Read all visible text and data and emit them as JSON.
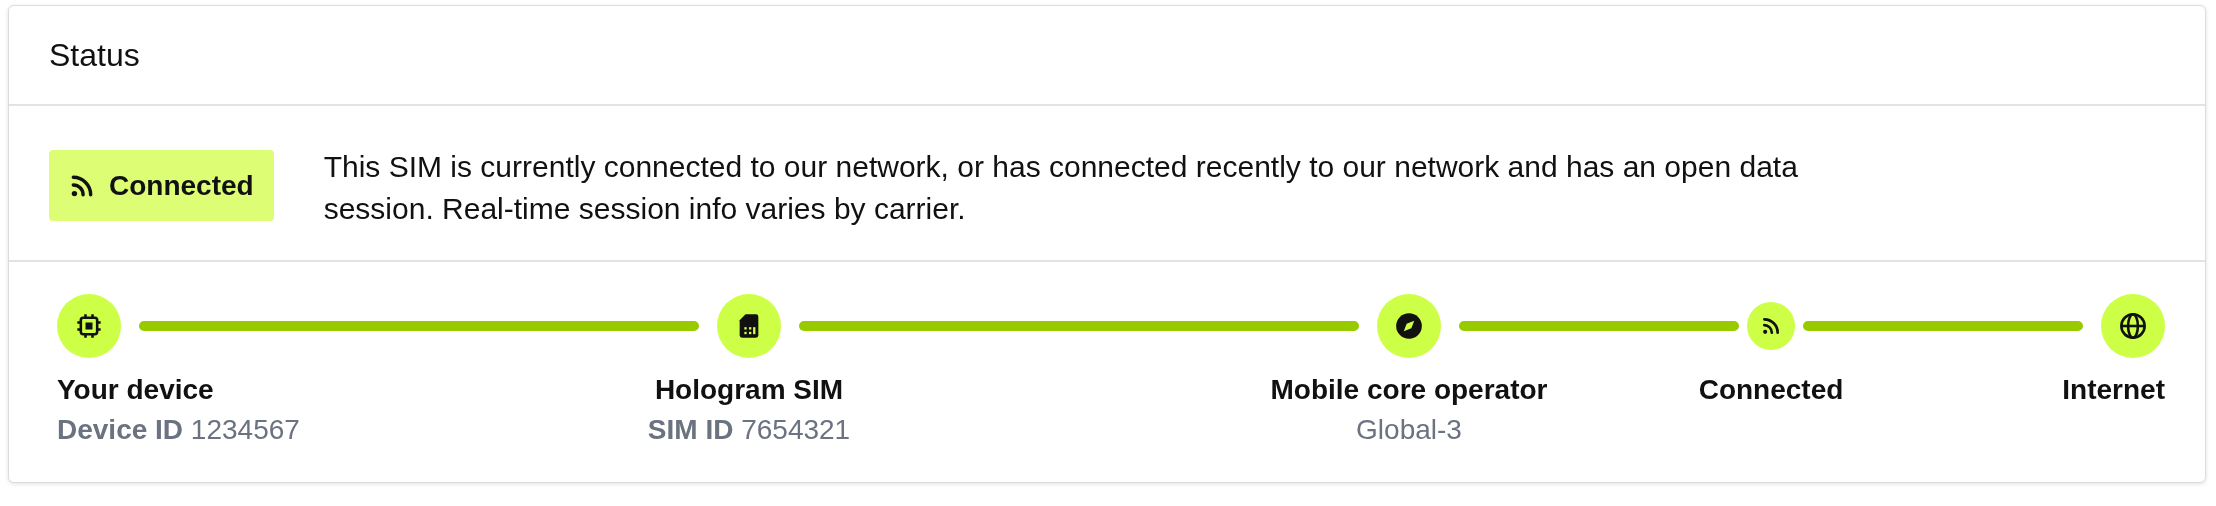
{
  "card": {
    "title": "Status"
  },
  "status": {
    "badge": "Connected",
    "description": "This SIM is currently connected to our network, or has connected recently to our network and has an open data session. Real-time session info varies by carrier."
  },
  "path": [
    {
      "kind": "node",
      "label": "Your device",
      "id_label": "Device ID",
      "id_value": "1234567"
    },
    {
      "kind": "node",
      "label": "Hologram SIM",
      "id_label": "SIM ID",
      "id_value": "7654321"
    },
    {
      "kind": "node",
      "label": "Mobile core operator",
      "id_value": "Global-3"
    },
    {
      "kind": "hop",
      "label": "Connected"
    },
    {
      "kind": "node",
      "label": "Internet"
    }
  ]
}
